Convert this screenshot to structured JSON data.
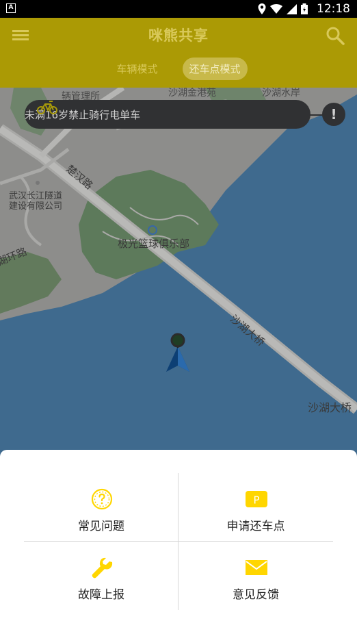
{
  "status_bar": {
    "time": "12:18"
  },
  "app_bar": {
    "title": "咪熊共享",
    "tabs": [
      {
        "label": "车辆模式",
        "active": false
      },
      {
        "label": "还车点模式",
        "active": true
      }
    ]
  },
  "notice": {
    "text": "未满16岁禁止骑行电单车",
    "alert_symbol": "!"
  },
  "map": {
    "labels": {
      "top_left": "辆管理所",
      "top_center": "沙湖金港苑",
      "top_right": "沙湖水岸",
      "road_chuhan": "楚汉路",
      "org": "武汉长江隧道",
      "org2": "建设有限公司",
      "club": "极光篮球俱乐部",
      "ring_road": "湖环路",
      "bridge_diag": "沙湖大桥",
      "bridge_right": "沙湖大桥"
    }
  },
  "menu": {
    "items": [
      {
        "label": "常见问题",
        "icon": "question-circle-icon"
      },
      {
        "label": "申请还车点",
        "icon": "parking-icon"
      },
      {
        "label": "故障上报",
        "icon": "wrench-icon"
      },
      {
        "label": "意见反馈",
        "icon": "mail-icon"
      }
    ]
  },
  "colors": {
    "accent": "#FFE000",
    "overlay_tint": "#ab9a05",
    "water": "#3d6f9a",
    "land": "#e8e4dc"
  }
}
